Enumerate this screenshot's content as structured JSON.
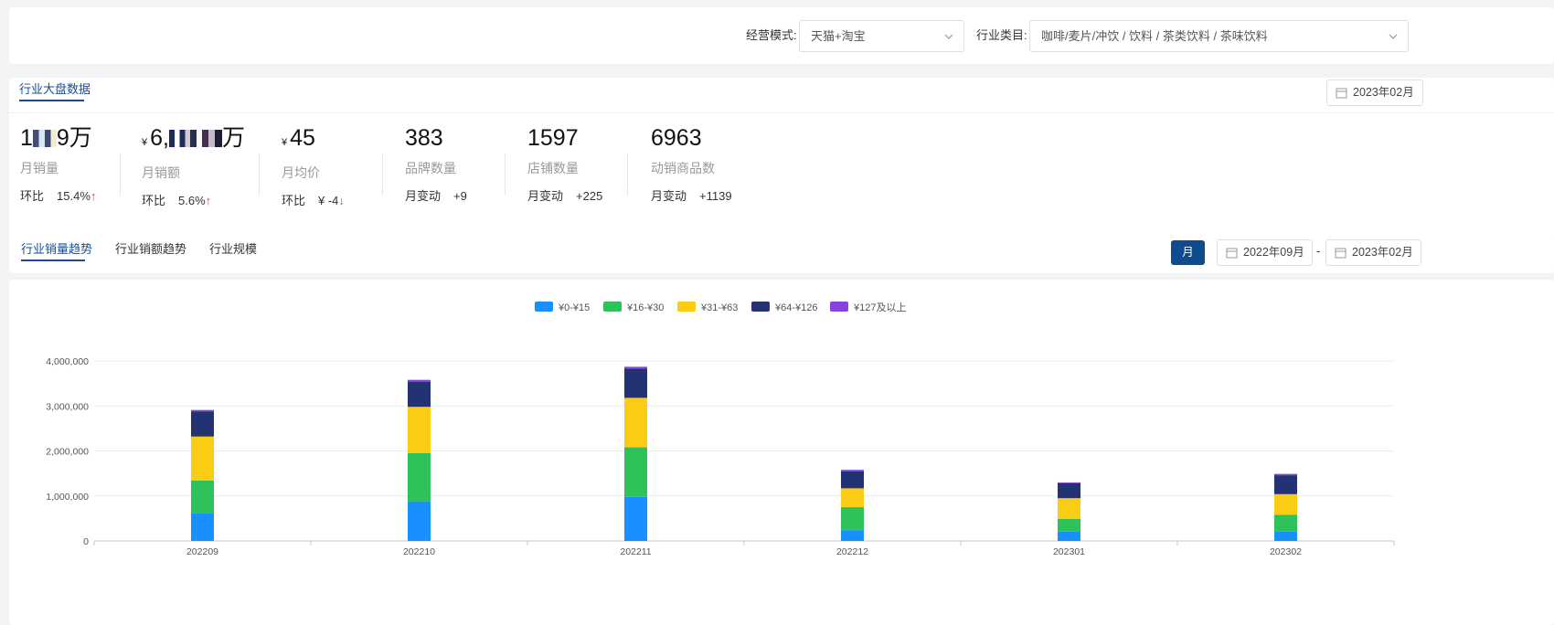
{
  "filters": {
    "mode_label": "经营模式:",
    "mode_value": "天猫+淘宝",
    "category_label": "行业类目:",
    "category_value": "咖啡/麦片/冲饮 / 饮料 / 茶类饮料 / 茶味饮料"
  },
  "overview": {
    "tab_label": "行业大盘数据",
    "date": "2023年02月",
    "metrics": [
      {
        "value_prefix": "1",
        "value_suffix": "9万",
        "label": "月销量",
        "sub_label": "环比",
        "sub_value": "15.4%",
        "trend": "↑"
      },
      {
        "currency": "¥",
        "value_prefix": "6,",
        "value_suffix": "万",
        "label": "月销额",
        "sub_label": "环比",
        "sub_value": "5.6%",
        "trend": "↑"
      },
      {
        "currency": "¥",
        "value": "45",
        "label": "月均价",
        "sub_label": "环比",
        "sub_value": "¥ -4",
        "trend": "↓"
      },
      {
        "value": "383",
        "label": "品牌数量",
        "sub_label": "月变动",
        "sub_value": "+9"
      },
      {
        "value": "1597",
        "label": "店铺数量",
        "sub_label": "月变动",
        "sub_value": "+225"
      },
      {
        "value": "6963",
        "label": "动销商品数",
        "sub_label": "月变动",
        "sub_value": "+1139"
      }
    ]
  },
  "trend": {
    "tabs": [
      "行业销量趋势",
      "行业销额趋势",
      "行业规模"
    ],
    "period_button": "月",
    "start_date": "2022年09月",
    "separator": "-",
    "end_date": "2023年02月"
  },
  "colors": {
    "accent": "#1a4d8f",
    "series": [
      "#1890ff",
      "#2fc25b",
      "#facc14",
      "#223273",
      "#8543e0"
    ]
  },
  "chart_data": {
    "type": "bar",
    "stacked": true,
    "categories": [
      "202209",
      "202210",
      "202211",
      "202212",
      "202301",
      "202302"
    ],
    "series": [
      {
        "name": "¥0-¥15",
        "values": [
          610000,
          880000,
          980000,
          240000,
          210000,
          210000
        ]
      },
      {
        "name": "¥16-¥30",
        "values": [
          730000,
          1070000,
          1100000,
          510000,
          280000,
          370000
        ]
      },
      {
        "name": "¥31-¥63",
        "values": [
          980000,
          1030000,
          1100000,
          420000,
          460000,
          460000
        ]
      },
      {
        "name": "¥64-¥126",
        "values": [
          560000,
          560000,
          650000,
          380000,
          330000,
          420000
        ]
      },
      {
        "name": "¥127及以上",
        "values": [
          30000,
          40000,
          40000,
          30000,
          20000,
          30000
        ]
      }
    ],
    "yticks": [
      "0",
      "1,000,000",
      "2,000,000",
      "3,000,000",
      "4,000,000"
    ],
    "ylim": [
      0,
      4000000
    ],
    "grid": true,
    "legend": "top-center"
  }
}
